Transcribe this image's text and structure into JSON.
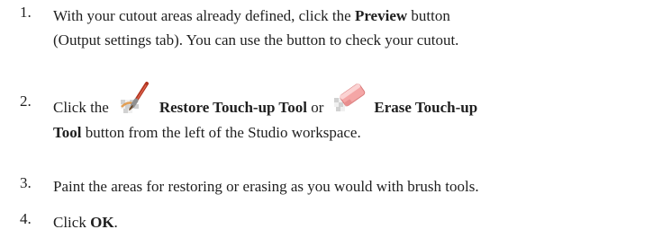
{
  "steps": [
    {
      "number": "1.",
      "line1_pre": "With your cutout areas already defined, click the ",
      "line1_bold": "Preview",
      "line1_post": " button",
      "line2": "(Output settings tab). You can use the button to check your cutout."
    },
    {
      "number": "2.",
      "pre": "Click the",
      "restore_icon": "restore-touch-up-brush-icon",
      "restore_label": "Restore Touch-up Tool",
      "mid": " or",
      "erase_icon": "eraser-icon",
      "erase_label": "Erase Touch-up",
      "line2_bold": "Tool",
      "line2_post": " button from the left of the Studio workspace."
    },
    {
      "number": "3.",
      "text": "Paint the areas for restoring or erasing as you would with brush tools."
    },
    {
      "number": "4.",
      "pre": "Click ",
      "bold": "OK",
      "post": "."
    }
  ],
  "colors": {
    "text": "#1f1f1f",
    "brush_red": "#c0392b",
    "eraser_pink": "#f4a6a6"
  }
}
